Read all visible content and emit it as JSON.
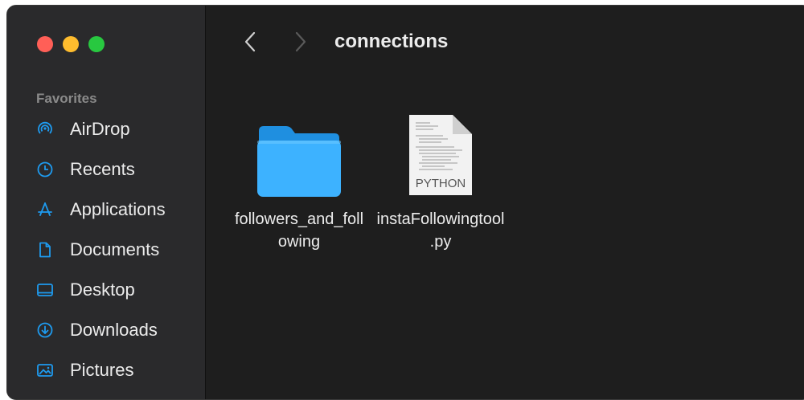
{
  "window": {
    "traffic_lights": [
      {
        "name": "close",
        "color": "#ff5f57"
      },
      {
        "name": "minimize",
        "color": "#febc2e"
      },
      {
        "name": "zoom",
        "color": "#28c840"
      }
    ]
  },
  "sidebar": {
    "section_title": "Favorites",
    "items": [
      {
        "label": "AirDrop",
        "icon": "airdrop-icon"
      },
      {
        "label": "Recents",
        "icon": "clock-icon"
      },
      {
        "label": "Applications",
        "icon": "applications-icon"
      },
      {
        "label": "Documents",
        "icon": "document-icon"
      },
      {
        "label": "Desktop",
        "icon": "desktop-icon"
      },
      {
        "label": "Downloads",
        "icon": "download-icon"
      },
      {
        "label": "Pictures",
        "icon": "pictures-icon"
      }
    ]
  },
  "toolbar": {
    "title": "connections",
    "back_icon": "chevron-left-icon",
    "forward_icon": "chevron-right-icon"
  },
  "files": [
    {
      "name": "followers_and_foll\nowing",
      "kind": "folder",
      "icon": "folder-icon"
    },
    {
      "name": "instaFollowingtool\n.py",
      "kind": "python-file",
      "icon": "python-file-icon",
      "badge": "PYTHON"
    }
  ],
  "colors": {
    "accent": "#1e9bf0",
    "folder": "#3db2ff",
    "text": "#ececec"
  }
}
